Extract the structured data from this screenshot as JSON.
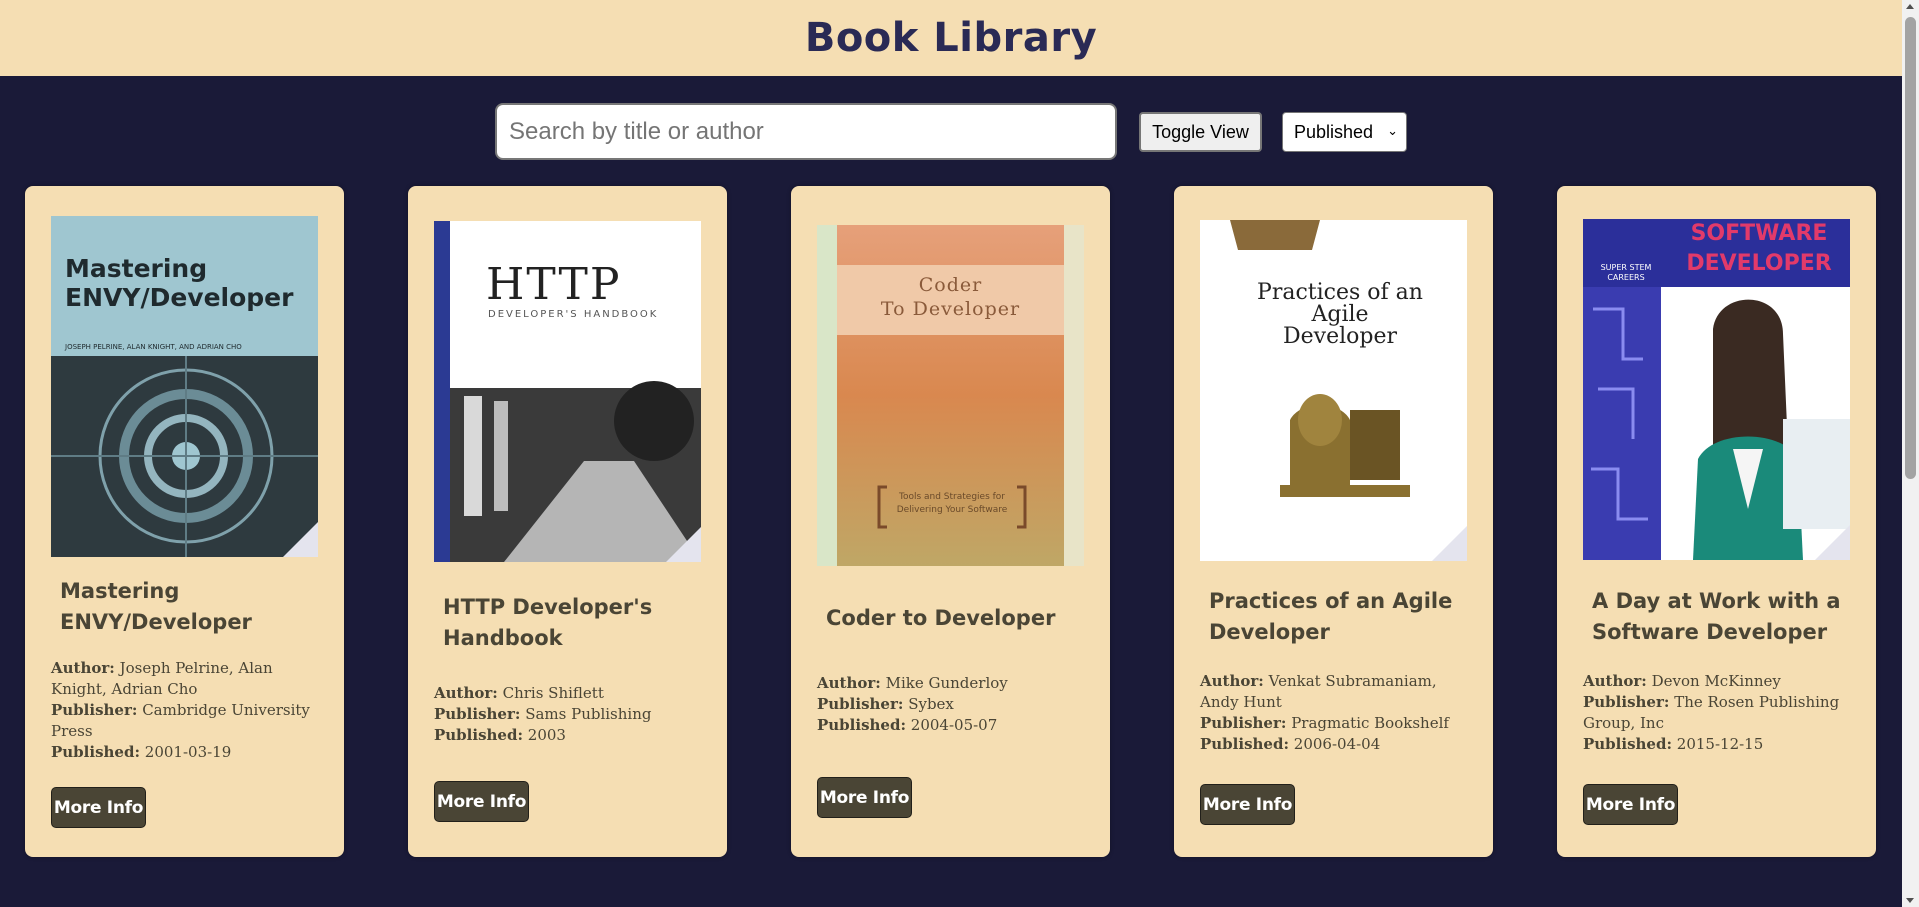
{
  "header": {
    "title": "Book Library"
  },
  "controls": {
    "search_placeholder": "Search by title or author",
    "toggle_label": "Toggle View",
    "sort_selected": "Published"
  },
  "labels": {
    "author": "Author:",
    "publisher": "Publisher:",
    "published": "Published:"
  },
  "books": [
    {
      "title": "Mastering ENVY/Developer",
      "author": "Joseph Pelrine, Alan Knight, Adrian Cho",
      "publisher": "Cambridge University Press",
      "published": "2001-03-19",
      "button": "More Info",
      "cover_text": [
        "Mastering",
        "ENVY/Developer"
      ],
      "cover_subtext": "JOSEPH PELRINE, ALAN KNIGHT, AND ADRIAN CHO"
    },
    {
      "title": "HTTP Developer's Handbook",
      "author": "Chris Shiflett",
      "publisher": "Sams Publishing",
      "published": "2003",
      "button": "More Info",
      "cover_text": [
        "HTTP"
      ],
      "cover_subtext": "DEVELOPER'S HANDBOOK"
    },
    {
      "title": "Coder to Developer",
      "author": "Mike Gunderloy",
      "publisher": "Sybex",
      "published": "2004-05-07",
      "button": "More Info",
      "cover_text": [
        "Coder",
        "To Developer"
      ],
      "cover_subtext": "Tools and Strategies for Delivering Your Software"
    },
    {
      "title": "Practices of an Agile Developer",
      "author": "Venkat Subramaniam, Andy Hunt",
      "publisher": "Pragmatic Bookshelf",
      "published": "2006-04-04",
      "button": "More Info",
      "cover_text": [
        "Practices of an",
        "Agile",
        "Developer"
      ],
      "cover_subtext": ""
    },
    {
      "title": "A Day at Work with a Software Developer",
      "author": "Devon McKinney",
      "publisher": "The Rosen Publishing Group, Inc",
      "published": "2015-12-15",
      "button": "More Info",
      "cover_text": [
        "SOFTWARE",
        "DEVELOPER"
      ],
      "cover_subtext": "SUPER STEM CAREERS"
    }
  ]
}
